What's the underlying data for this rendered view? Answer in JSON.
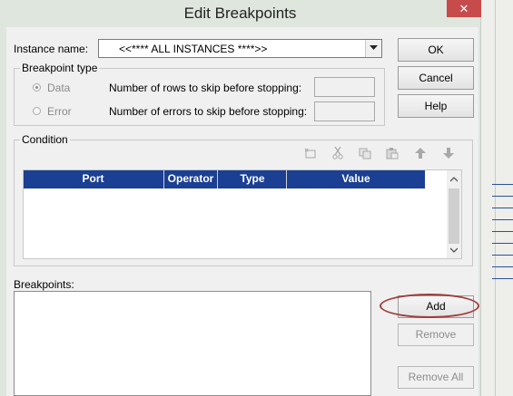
{
  "dialog": {
    "title": "Edit Breakpoints",
    "close_glyph": "✕"
  },
  "instance": {
    "label": "Instance name:",
    "value": "<<**** ALL INSTANCES ****>>"
  },
  "buttons": {
    "ok": "OK",
    "cancel": "Cancel",
    "help": "Help",
    "add": "Add",
    "remove": "Remove",
    "remove_all": "Remove All"
  },
  "breakpoint_type": {
    "title": "Breakpoint type",
    "data_label": "Data",
    "error_label": "Error",
    "selected": "Data",
    "rows_label": "Number of rows to skip before stopping:",
    "rows_value": "",
    "errors_label": "Number of errors to skip before stopping:",
    "errors_value": ""
  },
  "condition": {
    "title": "Condition",
    "columns": [
      "Port",
      "Operator",
      "Type",
      "Value"
    ],
    "rows": [],
    "toolbar_icons": [
      "new-icon",
      "cut-icon",
      "copy-icon",
      "paste-icon",
      "move-up-icon",
      "move-down-icon"
    ]
  },
  "breakpoints": {
    "label": "Breakpoints:",
    "items": []
  },
  "colors": {
    "header_blue": "#1b3f93",
    "highlight_ring": "#a23c3c",
    "close_red": "#c74b4b"
  }
}
